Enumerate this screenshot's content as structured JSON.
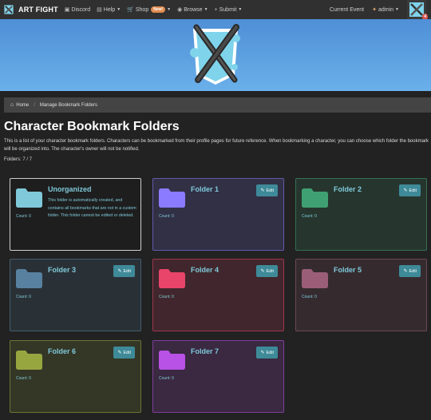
{
  "nav": {
    "brand": "ART FIGHT",
    "items": [
      {
        "icon": "discord-icon",
        "label": "Discord"
      },
      {
        "icon": "help-icon",
        "label": "Help"
      },
      {
        "icon": "cart-icon",
        "label": "Shop",
        "badge": "New!"
      },
      {
        "icon": "browse-icon",
        "label": "Browse"
      },
      {
        "icon": "plus-icon",
        "label": "Submit"
      }
    ],
    "current_event": "Current Event",
    "user": "admin",
    "notifications": "4"
  },
  "breadcrumb": {
    "home": "Home",
    "current": "Manage Bookmark Folders"
  },
  "page_title": "Character Bookmark Folders",
  "description": "This is a list of your character bookmark folders. Characters can be bookmarked from their profile pages for future reference. When bookmarking a character, you can choose which folder the bookmark will be organized into. The character's owner will not be notified.",
  "folders_count": "Folders: 7 / 7",
  "edit_label": "Edit",
  "folders": [
    {
      "name": "Unorganized",
      "count": "Count: 0",
      "color": "#7fc9da",
      "description": "This folder is automatically created, and contains all bookmarks that are not in a custom folder. This folder cannot be edited or deleted."
    },
    {
      "name": "Folder 1",
      "count": "Count: 0",
      "color": "#8a7bff"
    },
    {
      "name": "Folder 2",
      "count": "Count: 0",
      "color": "#3fa173"
    },
    {
      "name": "Folder 3",
      "count": "Count: 0",
      "color": "#57819f"
    },
    {
      "name": "Folder 4",
      "count": "Count: 0",
      "color": "#e9446a"
    },
    {
      "name": "Folder 5",
      "count": "Count: 0",
      "color": "#9a5e79"
    },
    {
      "name": "Folder 6",
      "count": "Count: 0",
      "color": "#98a640"
    },
    {
      "name": "Folder 7",
      "count": "Count: 0",
      "color": "#b851e6"
    }
  ]
}
